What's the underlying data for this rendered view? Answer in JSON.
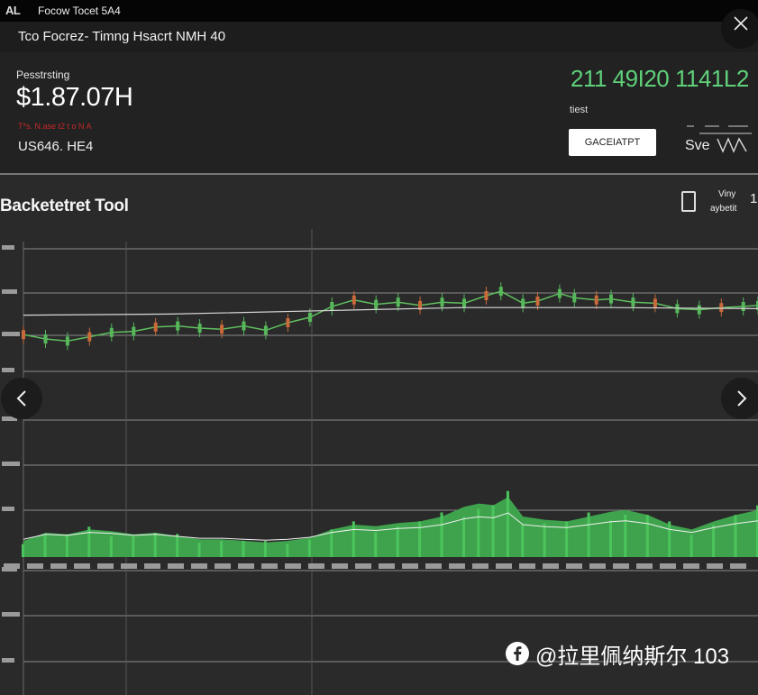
{
  "app": {
    "logo": "AL",
    "title": "Focow Tocet 5A4",
    "window_title": "Tco Focrez- Timng Hsacrt NMH 40"
  },
  "header": {
    "balance_label": "Pesstrsting",
    "balance_value": "$1.87.07H",
    "balance_sub": "T*s. N.ase t2 t o N A",
    "balance_currency": "US646. HE4",
    "ticker": "211 49I20 1141L2",
    "ticker_label": "tiest",
    "action_button_label": "GACEIATPT",
    "mini_readout": "Sve",
    "close_icon": "close-icon",
    "colors": {
      "accent_green": "#5fd07a",
      "alert_red": "#c62828"
    }
  },
  "section": {
    "title": "Backetetret Tool",
    "view_label": "Viny",
    "view_sub": "aybetit",
    "view_number": "1"
  },
  "navigation": {
    "prev_icon": "chevron-left-icon",
    "next_icon": "chevron-right-icon"
  },
  "watermark": {
    "icon": "facebook-icon",
    "text": "@拉里佩纳斯尔 103"
  },
  "chart_data": {
    "type": "line",
    "price_series": [
      {
        "x": 0,
        "y": 0.44
      },
      {
        "x": 0.03,
        "y": 0.4
      },
      {
        "x": 0.06,
        "y": 0.38
      },
      {
        "x": 0.09,
        "y": 0.42
      },
      {
        "x": 0.12,
        "y": 0.46
      },
      {
        "x": 0.15,
        "y": 0.47
      },
      {
        "x": 0.18,
        "y": 0.51
      },
      {
        "x": 0.21,
        "y": 0.52
      },
      {
        "x": 0.24,
        "y": 0.5
      },
      {
        "x": 0.27,
        "y": 0.49
      },
      {
        "x": 0.3,
        "y": 0.52
      },
      {
        "x": 0.33,
        "y": 0.48
      },
      {
        "x": 0.36,
        "y": 0.55
      },
      {
        "x": 0.39,
        "y": 0.6
      },
      {
        "x": 0.42,
        "y": 0.7
      },
      {
        "x": 0.45,
        "y": 0.76
      },
      {
        "x": 0.48,
        "y": 0.72
      },
      {
        "x": 0.51,
        "y": 0.74
      },
      {
        "x": 0.54,
        "y": 0.71
      },
      {
        "x": 0.57,
        "y": 0.74
      },
      {
        "x": 0.6,
        "y": 0.73
      },
      {
        "x": 0.63,
        "y": 0.8
      },
      {
        "x": 0.65,
        "y": 0.84
      },
      {
        "x": 0.68,
        "y": 0.73
      },
      {
        "x": 0.7,
        "y": 0.75
      },
      {
        "x": 0.73,
        "y": 0.82
      },
      {
        "x": 0.75,
        "y": 0.78
      },
      {
        "x": 0.78,
        "y": 0.76
      },
      {
        "x": 0.8,
        "y": 0.77
      },
      {
        "x": 0.83,
        "y": 0.74
      },
      {
        "x": 0.86,
        "y": 0.73
      },
      {
        "x": 0.89,
        "y": 0.68
      },
      {
        "x": 0.92,
        "y": 0.67
      },
      {
        "x": 0.95,
        "y": 0.69
      },
      {
        "x": 0.98,
        "y": 0.7
      },
      {
        "x": 1.0,
        "y": 0.71
      }
    ],
    "average_series": [
      {
        "x": 0,
        "y": 0.62
      },
      {
        "x": 0.2,
        "y": 0.63
      },
      {
        "x": 0.4,
        "y": 0.66
      },
      {
        "x": 0.6,
        "y": 0.69
      },
      {
        "x": 0.8,
        "y": 0.69
      },
      {
        "x": 1.0,
        "y": 0.68
      }
    ],
    "volume_series": [
      {
        "x": 0,
        "y": 0.2
      },
      {
        "x": 0.03,
        "y": 0.3
      },
      {
        "x": 0.06,
        "y": 0.28
      },
      {
        "x": 0.09,
        "y": 0.34
      },
      {
        "x": 0.12,
        "y": 0.32
      },
      {
        "x": 0.15,
        "y": 0.28
      },
      {
        "x": 0.18,
        "y": 0.3
      },
      {
        "x": 0.21,
        "y": 0.26
      },
      {
        "x": 0.24,
        "y": 0.22
      },
      {
        "x": 0.27,
        "y": 0.22
      },
      {
        "x": 0.3,
        "y": 0.2
      },
      {
        "x": 0.33,
        "y": 0.18
      },
      {
        "x": 0.36,
        "y": 0.2
      },
      {
        "x": 0.39,
        "y": 0.24
      },
      {
        "x": 0.42,
        "y": 0.34
      },
      {
        "x": 0.45,
        "y": 0.4
      },
      {
        "x": 0.48,
        "y": 0.38
      },
      {
        "x": 0.51,
        "y": 0.42
      },
      {
        "x": 0.54,
        "y": 0.44
      },
      {
        "x": 0.57,
        "y": 0.5
      },
      {
        "x": 0.6,
        "y": 0.62
      },
      {
        "x": 0.62,
        "y": 0.66
      },
      {
        "x": 0.64,
        "y": 0.64
      },
      {
        "x": 0.66,
        "y": 0.74
      },
      {
        "x": 0.68,
        "y": 0.5
      },
      {
        "x": 0.71,
        "y": 0.46
      },
      {
        "x": 0.74,
        "y": 0.44
      },
      {
        "x": 0.77,
        "y": 0.5
      },
      {
        "x": 0.8,
        "y": 0.56
      },
      {
        "x": 0.82,
        "y": 0.58
      },
      {
        "x": 0.85,
        "y": 0.52
      },
      {
        "x": 0.88,
        "y": 0.4
      },
      {
        "x": 0.91,
        "y": 0.34
      },
      {
        "x": 0.94,
        "y": 0.44
      },
      {
        "x": 0.97,
        "y": 0.52
      },
      {
        "x": 1.0,
        "y": 0.58
      }
    ],
    "grid": true
  }
}
